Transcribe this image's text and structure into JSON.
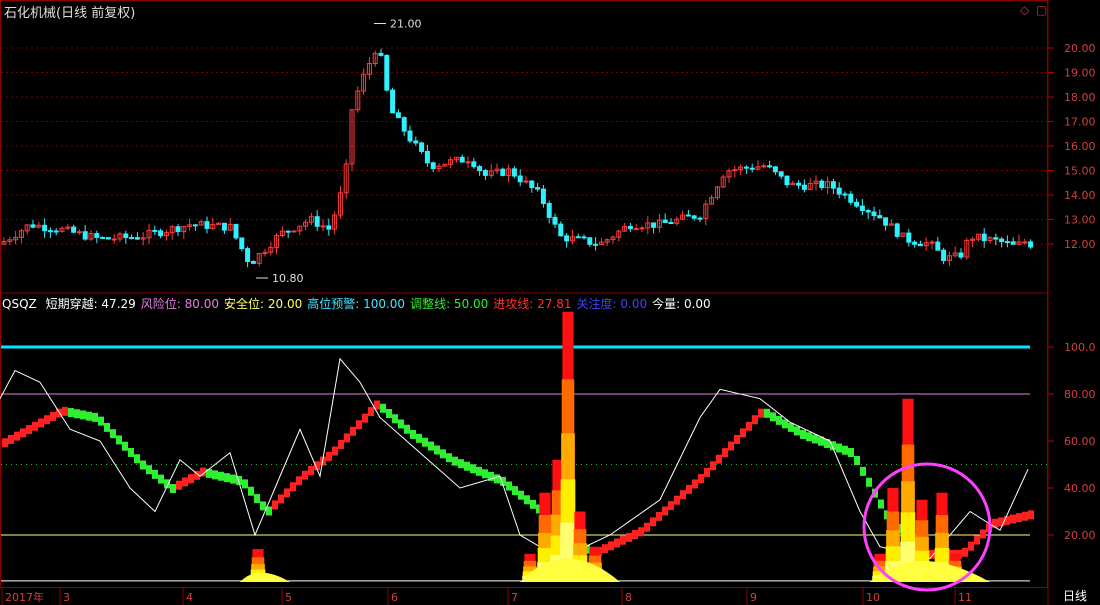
{
  "title": "石化机械(日线 前复权)",
  "icons": {
    "diamond": "diamond-icon",
    "window": "window-icon"
  },
  "price_axis": {
    "ticks": [
      "20.00",
      "19.00",
      "18.00",
      "17.00",
      "16.00",
      "15.00",
      "14.00",
      "13.00",
      "12.00"
    ]
  },
  "price_marks": {
    "high": "21.00",
    "low": "10.80"
  },
  "indicator": {
    "name": "QSQZ",
    "items": [
      {
        "label": "短期穿越:",
        "value": "47.29",
        "color": "#ffffff"
      },
      {
        "label": "风险位:",
        "value": "80.00",
        "color": "#e080e0"
      },
      {
        "label": "安全位:",
        "value": "20.00",
        "color": "#ffff60"
      },
      {
        "label": "高位预警:",
        "value": "100.00",
        "color": "#40e8ff"
      },
      {
        "label": "调整线:",
        "value": "50.00",
        "color": "#30ee30"
      },
      {
        "label": "进攻线:",
        "value": "27.81",
        "color": "#ff3030"
      },
      {
        "label": "关注度:",
        "value": "0.00",
        "color": "#4040ff"
      },
      {
        "label": "今量:",
        "value": "0.00",
        "color": "#ffffff"
      }
    ]
  },
  "ind_axis": {
    "ticks": [
      "100.0",
      "80.00",
      "60.00",
      "40.00",
      "20.00"
    ]
  },
  "time_axis": {
    "labels": [
      "2017年",
      "3",
      "4",
      "5",
      "6",
      "7",
      "8",
      "9",
      "10",
      "11"
    ]
  },
  "period_tab": "日线",
  "colors": {
    "up": "#ff3b3b",
    "down": "#2ef0ff",
    "grid": "#7a0000",
    "warning": "#00e8ff",
    "risk": "#e080e0",
    "safe": "#ffff80",
    "adjust": "#30ee30",
    "attack": "#ff2020",
    "highlight": "#ff40ff"
  }
}
